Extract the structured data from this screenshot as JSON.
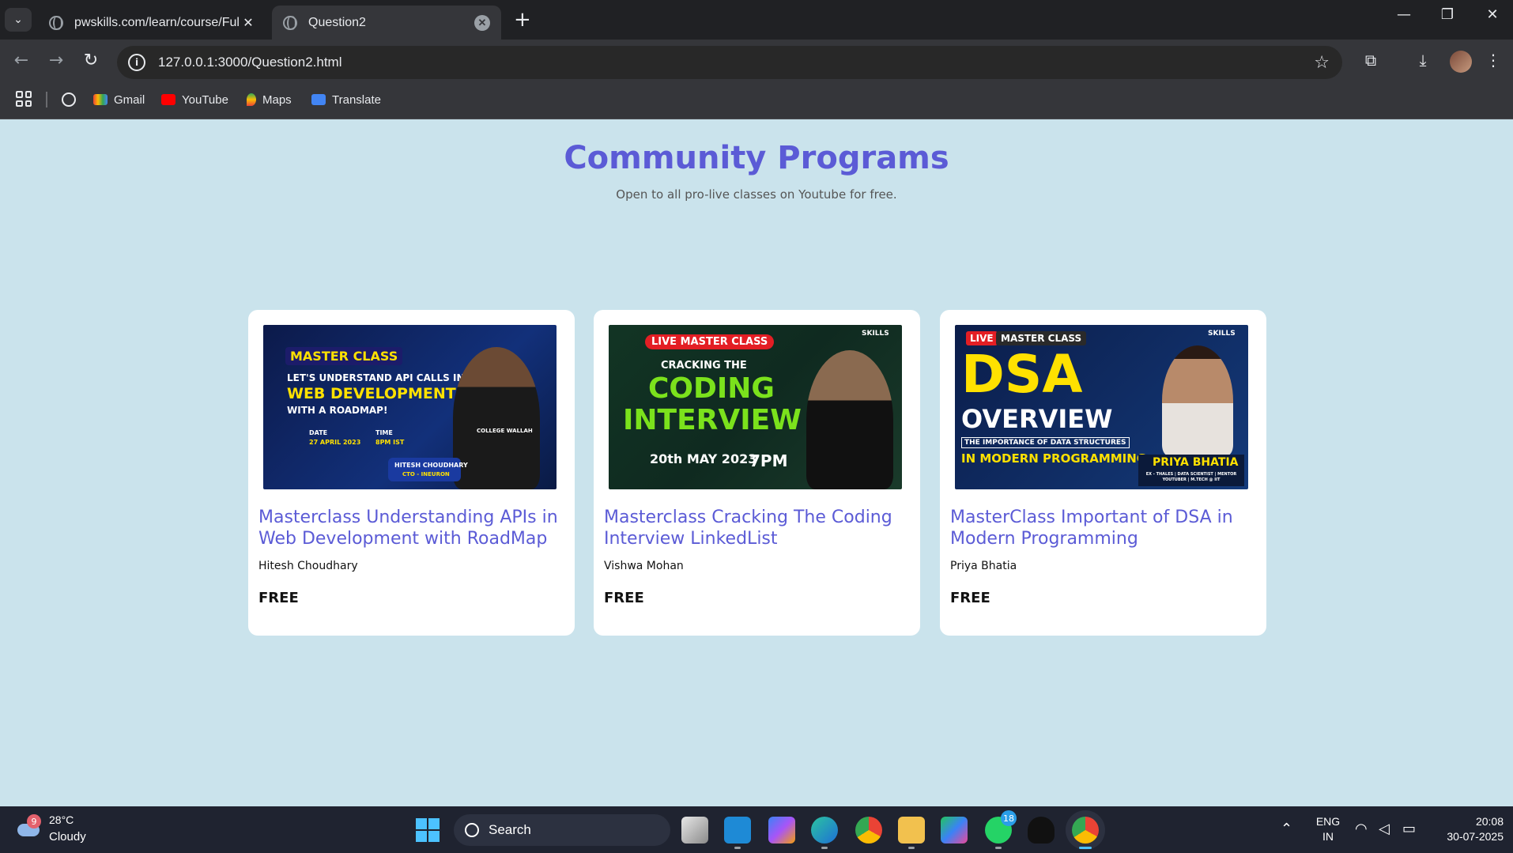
{
  "browser": {
    "tabs": [
      {
        "title": "pwskills.com/learn/course/Full-"
      },
      {
        "title": "Question2"
      }
    ],
    "url": "127.0.0.1:3000/Question2.html",
    "bookmarks": [
      {
        "label": "Gmail",
        "icon": "gmail-icon"
      },
      {
        "label": "YouTube",
        "icon": "youtube-icon"
      },
      {
        "label": "Maps",
        "icon": "maps-icon"
      },
      {
        "label": "Translate",
        "icon": "translate-icon"
      }
    ]
  },
  "page": {
    "title": "Community Programs",
    "subtitle": "Open to all pro-live classes on Youtube for free.",
    "cards": [
      {
        "title": "Masterclass Understanding APIs in Web Development with RoadMap",
        "author": "Hitesh Choudhary",
        "price": "FREE",
        "thumb": {
          "badge": "MASTER CLASS",
          "line1": "LET'S UNDERSTAND API CALLS IN",
          "line2": "WEB DEVELOPMENT",
          "line3": "WITH A ROADMAP!",
          "date_label": "DATE",
          "date": "27 APRIL 2023",
          "time_label": "TIME",
          "time": "8PM IST",
          "presenter": "HITESH CHOUDHARY",
          "role": "CTO - INEURON",
          "shirt": "COLLEGE WALLAH"
        }
      },
      {
        "title": "Masterclass Cracking The Coding Interview LinkedList",
        "author": "Vishwa Mohan",
        "price": "FREE",
        "thumb": {
          "badge": "LIVE MASTER CLASS",
          "brand": "SKILLS",
          "line1": "CRACKING THE",
          "line2": "CODING",
          "line3": "INTERVIEW",
          "date": "20th MAY 2023",
          "time": "7PM"
        }
      },
      {
        "title": "MasterClass Important of DSA in Modern Programming",
        "author": "Priya Bhatia",
        "price": "FREE",
        "thumb": {
          "badge_live": "LIVE",
          "badge": "MASTER CLASS",
          "brand": "SKILLS",
          "line1": "DSA",
          "line2": "OVERVIEW",
          "line3": "THE IMPORTANCE OF DATA STRUCTURES",
          "line4": "IN MODERN PROGRAMMING",
          "presenter": "PRIYA BHATIA",
          "role": "EX - THALES | DATA SCIENTIST | MENTOR YOUTUBER | M.TECH @ IIT"
        }
      }
    ]
  },
  "taskbar": {
    "weather_badge": "9",
    "temperature": "28°C",
    "condition": "Cloudy",
    "search_label": "Search",
    "whatsapp_badge": "18",
    "lang_top": "ENG",
    "lang_bottom": "IN",
    "time": "20:08",
    "date": "30-07-2025"
  }
}
